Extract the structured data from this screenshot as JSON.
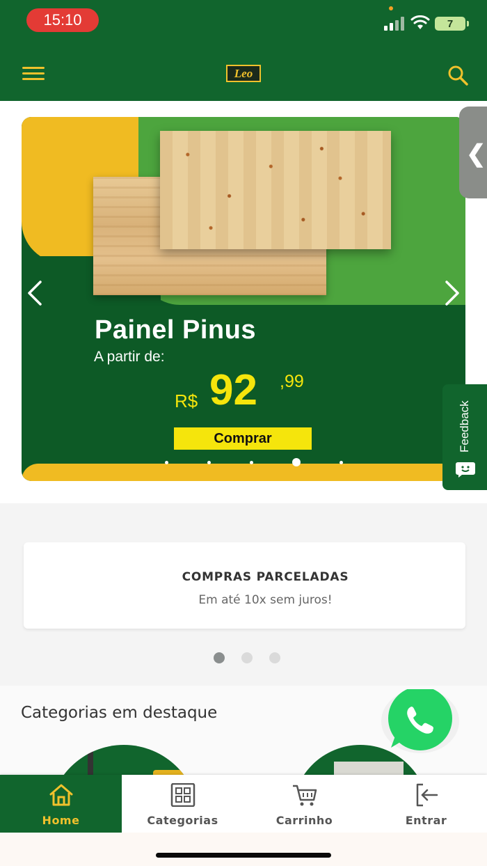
{
  "status_bar": {
    "time": "15:10",
    "battery": "7"
  },
  "header": {
    "logo_text": "Leo"
  },
  "banner": {
    "title": "Painel Pinus",
    "subtitle": "A partir de:",
    "currency": "R$",
    "price_int": "92",
    "price_cents": ",99",
    "button_label": "Comprar",
    "slide_count": 5,
    "active_slide": 4
  },
  "feedback": {
    "label": "Feedback"
  },
  "promo": {
    "title": "COMPRAS PARCELADAS",
    "subtitle": "Em até 10x sem juros!",
    "dots": 3,
    "active_dot": 1
  },
  "categories": {
    "heading": "Categorias em destaque"
  },
  "bottom_nav": {
    "items": [
      {
        "label": "Home",
        "icon": "home-icon",
        "active": true
      },
      {
        "label": "Categorias",
        "icon": "grid-icon",
        "active": false
      },
      {
        "label": "Carrinho",
        "icon": "cart-icon",
        "active": false
      },
      {
        "label": "Entrar",
        "icon": "login-icon",
        "active": false
      }
    ]
  },
  "colors": {
    "brand_green": "#11652d",
    "brand_yellow": "#f0c12c",
    "price_yellow": "#f5e50c",
    "whatsapp_green": "#25d366"
  }
}
